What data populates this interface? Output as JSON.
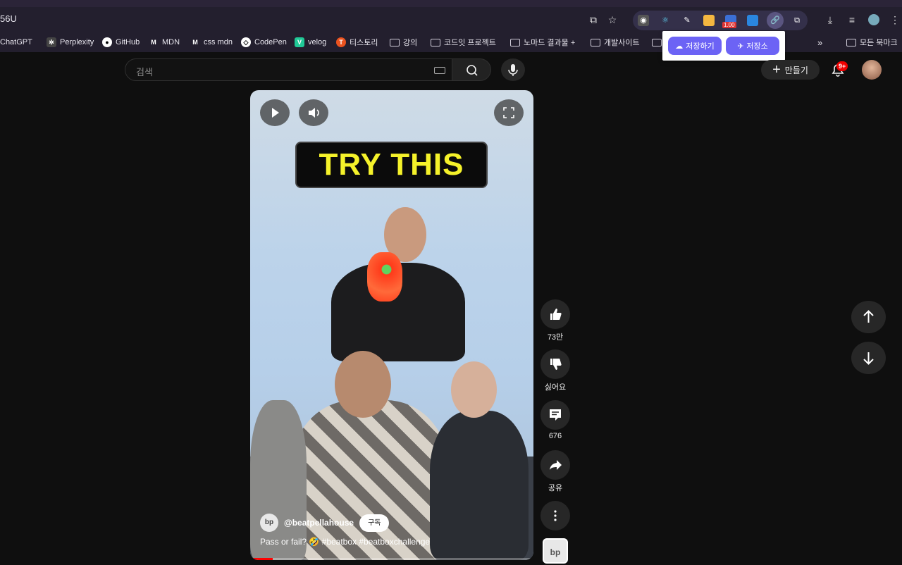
{
  "browser": {
    "url": "56U",
    "bookmarks": [
      {
        "label": "ChatGPT",
        "icon": "chatgpt-icon"
      },
      {
        "label": "Perplexity",
        "icon": "perplexity-icon"
      },
      {
        "label": "GitHub",
        "icon": "github-icon"
      },
      {
        "label": "MDN",
        "icon": "mdn-icon"
      },
      {
        "label": "css mdn",
        "icon": "mdn-icon"
      },
      {
        "label": "CodePen",
        "icon": "codepen-icon"
      },
      {
        "label": "velog",
        "icon": "velog-icon"
      },
      {
        "label": "티스토리",
        "icon": "tistory-icon"
      },
      {
        "label": "강의",
        "icon": "folder-icon"
      },
      {
        "label": "코드잇 프로젝트",
        "icon": "folder-icon"
      },
      {
        "label": "노마드 결과물 +",
        "icon": "folder-icon"
      },
      {
        "label": "개발사이트",
        "icon": "folder-icon"
      }
    ],
    "all_bookmarks": "모든 북마크",
    "ext_badge": "1.00",
    "popup": {
      "save": "저장하기",
      "storage": "저장소"
    }
  },
  "header": {
    "search_placeholder": "검색",
    "create_label": "만들기",
    "notif_count": "9+"
  },
  "video": {
    "overlay_text": "TRY THIS",
    "channel": "@beatpellahouse",
    "subscribe": "구독",
    "caption": "Pass or fail? 🤣 #beatbox #beatboxchallenge",
    "progress": 0.08
  },
  "actions": {
    "like_count": "73만",
    "dislike_label": "싫어요",
    "comment_count": "676",
    "share_label": "공유"
  },
  "colors": {
    "accent": "#6c63f5",
    "yt_red": "#ff0000",
    "overlay_text": "#f5f22a"
  }
}
